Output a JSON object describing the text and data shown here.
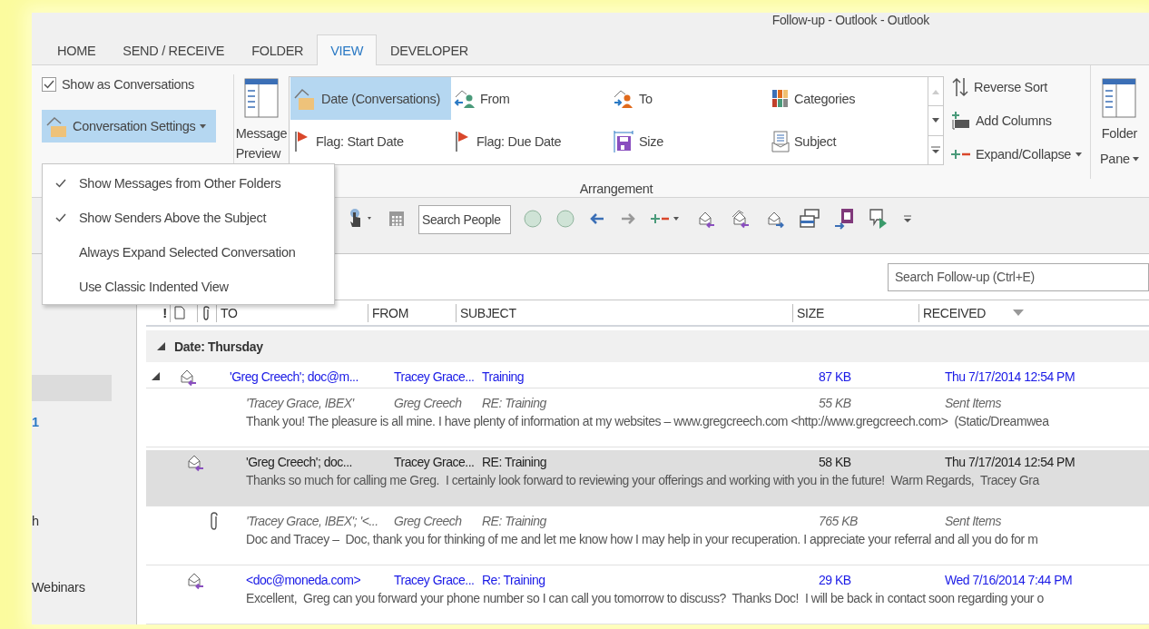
{
  "window": {
    "title": "Follow-up - Outlook - Outlook"
  },
  "tabs": [
    {
      "label": "HOME",
      "selected": false
    },
    {
      "label": "SEND / RECEIVE",
      "selected": false
    },
    {
      "label": "FOLDER",
      "selected": false
    },
    {
      "label": "VIEW",
      "selected": true
    },
    {
      "label": "DEVELOPER",
      "selected": false
    }
  ],
  "ribbon": {
    "show_as_conversations": {
      "label": "Show as Conversations",
      "checked": true
    },
    "conversation_settings": {
      "label": "Conversation Settings",
      "expanded": true
    },
    "message_preview": {
      "lines": [
        "Message",
        "Preview"
      ]
    },
    "arrangement": {
      "label": "Arrangement",
      "items": [
        {
          "label": "Date (Conversations)",
          "selected": true
        },
        {
          "label": "From",
          "selected": false
        },
        {
          "label": "To",
          "selected": false
        },
        {
          "label": "Categories",
          "selected": false
        },
        {
          "label": "Flag: Start Date",
          "selected": false
        },
        {
          "label": "Flag: Due Date",
          "selected": false
        },
        {
          "label": "Size",
          "selected": false
        },
        {
          "label": "Subject",
          "selected": false
        }
      ]
    },
    "sort_actions": [
      {
        "label": "Reverse Sort",
        "dropdown": false
      },
      {
        "label": "Add Columns",
        "dropdown": false
      },
      {
        "label": "Expand/Collapse",
        "dropdown": true
      }
    ],
    "folder_pane": {
      "lines": [
        "Folder",
        "Pane"
      ]
    }
  },
  "conversation_menu": [
    {
      "label": "Show Messages from Other Folders",
      "checked": true
    },
    {
      "label": "Show Senders Above the Subject",
      "checked": true
    },
    {
      "label": "Always Expand Selected Conversation",
      "checked": false
    },
    {
      "label": "Use Classic Indented View",
      "checked": false
    }
  ],
  "toolbar": {
    "search_people": {
      "placeholder": "Search People"
    }
  },
  "nav": [
    {
      "kind": "blank",
      "selected": true
    },
    {
      "kind": "count",
      "text": "1",
      "selected": false
    },
    {
      "kind": "label",
      "text": "h",
      "selected": false
    },
    {
      "kind": "label",
      "text": "Webinars",
      "selected": false
    }
  ],
  "search": {
    "placeholder": "Search Follow-up (Ctrl+E)"
  },
  "list": {
    "importance": "!",
    "columns": [
      {
        "label": "TO",
        "sorted": false
      },
      {
        "label": "FROM",
        "sorted": false
      },
      {
        "label": "SUBJECT",
        "sorted": false
      },
      {
        "label": "SIZE",
        "sorted": false
      },
      {
        "label": "RECEIVED",
        "sorted": true
      }
    ],
    "group": {
      "label": "Date: Thursday",
      "expanded": true
    },
    "messages": [
      {
        "kind": "conversation",
        "expanded": true,
        "unread": true,
        "selected": false,
        "sent": false,
        "attachment": false,
        "to": "'Greg Creech'; doc@m...",
        "from": "Tracey Grace...",
        "subject": "Training",
        "size": "87 KB",
        "received": "Thu 7/17/2014 12:54 PM"
      },
      {
        "kind": "message",
        "unread": false,
        "selected": false,
        "sent": true,
        "attachment": false,
        "to": "'Tracey Grace, IBEX'",
        "from": "Greg Creech",
        "subject": "RE: Training",
        "size": "55 KB",
        "received": "Sent Items",
        "preview": "Thank you! The pleasure is all mine. I have plenty of information at my websites – www.gregcreech.com <http://www.gregcreech.com>  (Static/Dreamwea"
      },
      {
        "kind": "message",
        "unread": false,
        "selected": true,
        "sent": false,
        "attachment": false,
        "to": "'Greg Creech'; doc...",
        "from": "Tracey Grace...",
        "subject": "RE: Training",
        "size": "58 KB",
        "received": "Thu 7/17/2014 12:54 PM",
        "preview": "Thanks so much for calling me Greg.  I certainly look forward to reviewing your offerings and working with you in the future!  Warm Regards,  Tracey Gra"
      },
      {
        "kind": "message",
        "unread": false,
        "selected": false,
        "sent": true,
        "attachment": true,
        "to": "'Tracey Grace, IBEX'; '<...",
        "from": "Greg Creech",
        "subject": "RE: Training",
        "size": "765 KB",
        "received": "Sent Items",
        "preview": "Doc and Tracey –  Doc, thank you for thinking of me and let me know how I may help in your recuperation. I appreciate your referral and all you do for m"
      },
      {
        "kind": "message",
        "unread": true,
        "selected": false,
        "sent": false,
        "attachment": false,
        "to": "<doc@moneda.com>",
        "from": "Tracey Grace...",
        "subject": "Re: Training",
        "size": "29 KB",
        "received": "Wed 7/16/2014 7:44 PM",
        "preview": "Excellent,  Greg can you forward your phone number so I can call you tomorrow to discuss?  Thanks Doc!  I will be back in contact soon regarding your o"
      }
    ]
  }
}
